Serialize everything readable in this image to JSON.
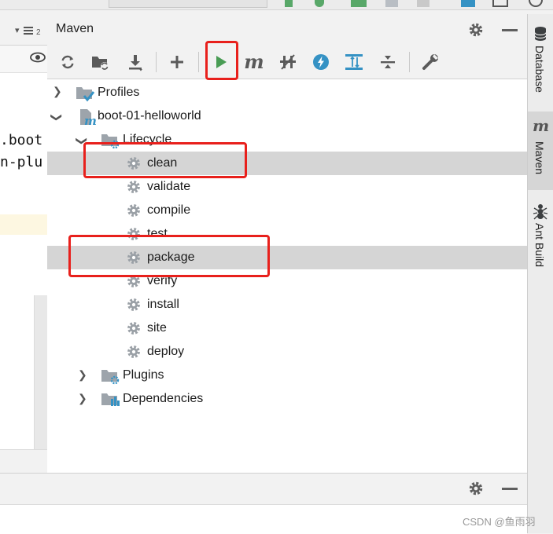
{
  "window": {
    "title": "Maven"
  },
  "editor": {
    "code_lines": [
      ".boot",
      "n-plu"
    ],
    "sort_icon_label": "2"
  },
  "toolbar": {
    "buttons": [
      {
        "name": "reimport-icon"
      },
      {
        "name": "generate-sources-icon"
      },
      {
        "name": "download-icon"
      },
      {
        "name": "add-icon"
      },
      {
        "name": "run-icon"
      },
      {
        "name": "execute-goal-icon"
      },
      {
        "name": "toggle-offline-icon"
      },
      {
        "name": "skip-tests-icon"
      },
      {
        "name": "show-dependencies-icon"
      },
      {
        "name": "collapse-all-icon"
      },
      {
        "name": "settings-wrench-icon"
      }
    ],
    "execute_goal_glyph": "m"
  },
  "tree": {
    "profiles_label": "Profiles",
    "project_label": "boot-01-helloworld",
    "lifecycle_label": "Lifecycle",
    "lifecycle_goals": [
      "clean",
      "validate",
      "compile",
      "test",
      "package",
      "verify",
      "install",
      "site",
      "deploy"
    ],
    "selected_goals": [
      "clean",
      "package"
    ],
    "plugins_label": "Plugins",
    "dependencies_label": "Dependencies"
  },
  "sidebar": {
    "tabs": [
      {
        "label": "Database",
        "active": false
      },
      {
        "label": "Maven",
        "active": true
      },
      {
        "label": "Ant Build",
        "active": false
      }
    ],
    "maven_glyph": "m"
  },
  "watermark": "CSDN @鱼雨羽",
  "colors": {
    "run_green": "#499c54",
    "annotation_red": "#e8201c",
    "selection": "#d5d5d5",
    "gear_grey": "#9aa0a6",
    "folder_grey": "#9da4ab",
    "accent_blue": "#3592c4"
  }
}
